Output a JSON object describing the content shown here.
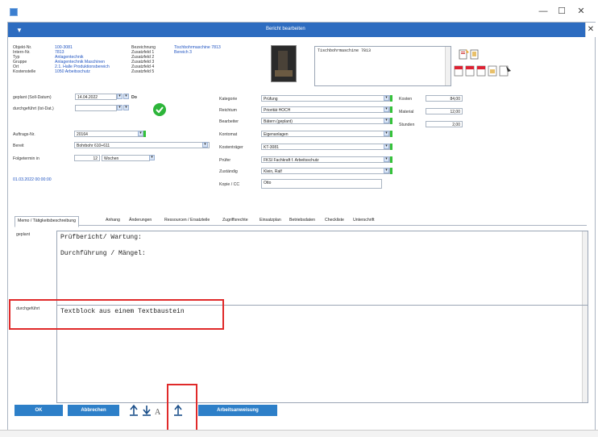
{
  "window": {
    "minimize": "—",
    "maximize": "☐",
    "close": "✕"
  },
  "dialog": {
    "title": "Bericht bearbeiten",
    "close": "✕"
  },
  "info_left": [
    {
      "label": "Objekt-Nr.",
      "value": "100-3081"
    },
    {
      "label": "Intern-Nr.",
      "value": "7813"
    },
    {
      "label": "Typ",
      "value": "Anlagentechnik"
    },
    {
      "label": "Gruppe",
      "value": "Anlagentechnik Maschinen"
    },
    {
      "label": "Ort",
      "value": "2.1. Halle Produktionsbereich"
    },
    {
      "label": "Kostenstelle",
      "value": "1050 Arbeitsschutz"
    }
  ],
  "info_mid": [
    {
      "label": "Bezeichnung",
      "value": "Tischbohrmaschine 7813"
    },
    {
      "label": "Zusatzfeld 1",
      "value": "Bereich 3"
    },
    {
      "label": "Zusatzfeld 2",
      "value": ""
    },
    {
      "label": "Zusatzfeld 3",
      "value": ""
    },
    {
      "label": "Zusatzfeld 4",
      "value": ""
    },
    {
      "label": "Zusatzfeld 5",
      "value": ""
    }
  ],
  "description_text": "Tischbohrmaschine 7813",
  "form_left": {
    "geplant_label": "geplant (Soll-Datum)",
    "geplant_value": "14.04.2022",
    "geplant_suffix": "Do",
    "durchgefuehrt_label": "durchgeführt (Ist-Dat.)",
    "durchgefuehrt_value": "",
    "auftrag_label": "Auftrags-Nr.",
    "auftrag_value": "20164",
    "bereit_label": "Bereit",
    "bereit_value": "Bohrbohr 610+611",
    "folgetermin_label": "Folgetermin in",
    "folgetermin_num": "12",
    "folgetermin_unit": "Wochen",
    "timestamp": "01.03.2022 00:00:00"
  },
  "form_mid": [
    {
      "label": "Kategorie",
      "value": "Prüfung"
    },
    {
      "label": "Reichtum",
      "value": "Priorität HOCH"
    },
    {
      "label": "Bearbeiter",
      "value": "Bätern (geplant)"
    },
    {
      "label": "Kontomat",
      "value": "Eigenanlagen"
    },
    {
      "label": "Kostenträger",
      "value": "KT-3081"
    },
    {
      "label": "Prüfer",
      "value": "FKSI Fachkraft f. Arbeitsschutz"
    },
    {
      "label": "Zuständig",
      "value": "Klein, Ralf"
    },
    {
      "label": "Kopie / CC",
      "value": "Otto"
    }
  ],
  "form_right": [
    {
      "label": "Kosten",
      "value": "84,00"
    },
    {
      "label": "Material",
      "value": "12,00"
    },
    {
      "label": "Stunden",
      "value": "2,00"
    }
  ],
  "tabs": [
    "Memo / Tätigkeitsbeschreibung",
    "Anhang",
    "Änderungen",
    "Ressourcen / Ersatzteile",
    "Zugriffsrechte",
    "Einsatzplan",
    "Betriebsdaten",
    "Checkliste",
    "Unterschrift"
  ],
  "memo": {
    "geplant_label": "geplant",
    "geplant_text": "Prüfbericht/ Wartung:\n\nDurchführung / Mängel:",
    "durchgefuehrt_label": "durchgeführt",
    "durchgefuehrt_text": "Textblock aus einem Textbaustein"
  },
  "buttons": {
    "ok": "OK",
    "cancel": "Abbrechen",
    "instruction": "Arbeitsanweisung",
    "letter_icon_char": "A"
  },
  "colors": {
    "accent": "#2d7fc8",
    "title_bar": "#2d6cc0",
    "value_text": "#2155c2",
    "highlight": "#e02a2a",
    "status_ok": "#2db53a"
  }
}
